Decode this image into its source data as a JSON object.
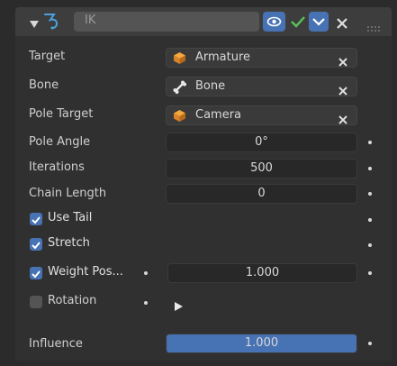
{
  "header": {
    "name_value": "IK",
    "colors": {
      "eye_bg": "#4772b3",
      "check": "#58c35a",
      "name_bg": "#545454"
    },
    "icons": [
      "expand-triangle-icon",
      "ik-constraint-icon",
      "eye-icon",
      "check-icon",
      "chevron-down-icon",
      "close-icon",
      "drag-handle-icon"
    ]
  },
  "props": {
    "target": {
      "label": "Target",
      "value": "Armature",
      "icon": "cube-icon"
    },
    "bone": {
      "label": "Bone",
      "value": "Bone",
      "icon": "bone-icon"
    },
    "pole_target": {
      "label": "Pole Target",
      "value": "Camera",
      "icon": "cube-icon"
    },
    "pole_angle": {
      "label": "Pole Angle",
      "value": "0°"
    },
    "iterations": {
      "label": "Iterations",
      "value": "500"
    },
    "chain_length": {
      "label": "Chain Length",
      "value": "0"
    },
    "use_tail": {
      "label": "Use Tail",
      "checked": true
    },
    "stretch": {
      "label": "Stretch",
      "checked": true
    },
    "weight_pos": {
      "label": "Weight Pos...",
      "checked": true,
      "value": "1.000"
    },
    "rotation": {
      "label": "Rotation",
      "checked": false
    },
    "influence": {
      "label": "Influence",
      "value": "1.000",
      "fraction": 1.0,
      "color": "#4772b3"
    }
  }
}
